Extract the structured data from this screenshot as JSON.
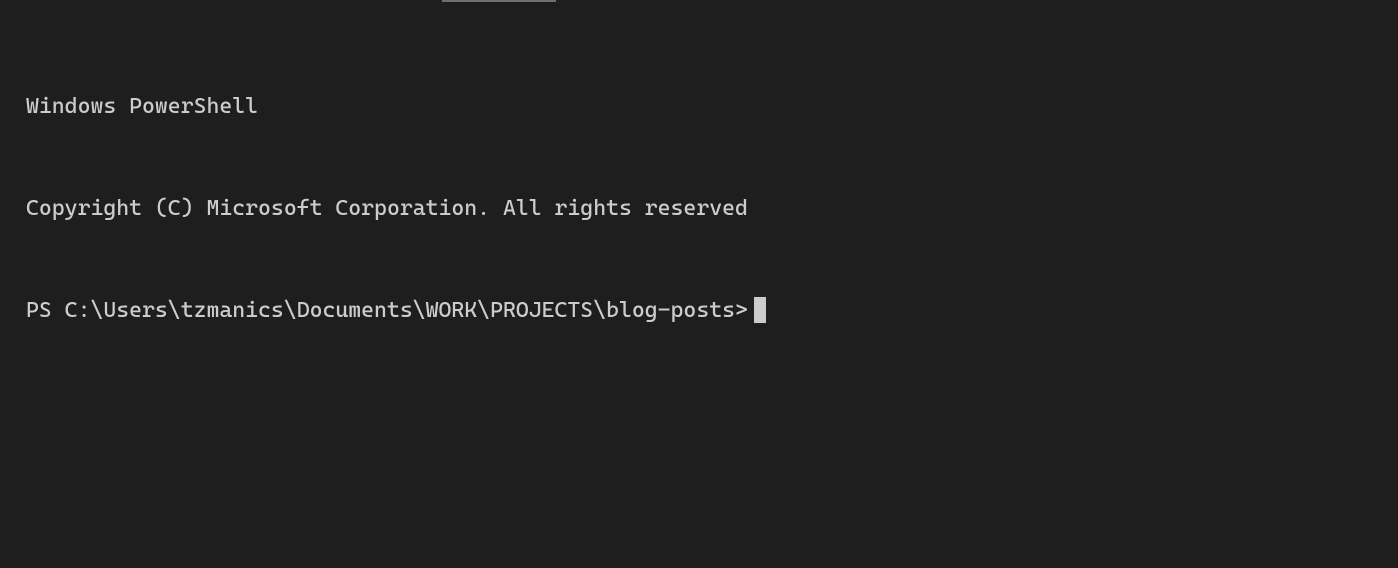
{
  "header": {
    "title": "Windows PowerShell",
    "copyright": "Copyright (C) Microsoft Corporation. All rights reserved"
  },
  "prompt": {
    "prefix": "PS ",
    "path": "C:\\Users\\tzmanics\\Documents\\WORK\\PROJECTS\\blog-posts",
    "suffix": ">"
  }
}
